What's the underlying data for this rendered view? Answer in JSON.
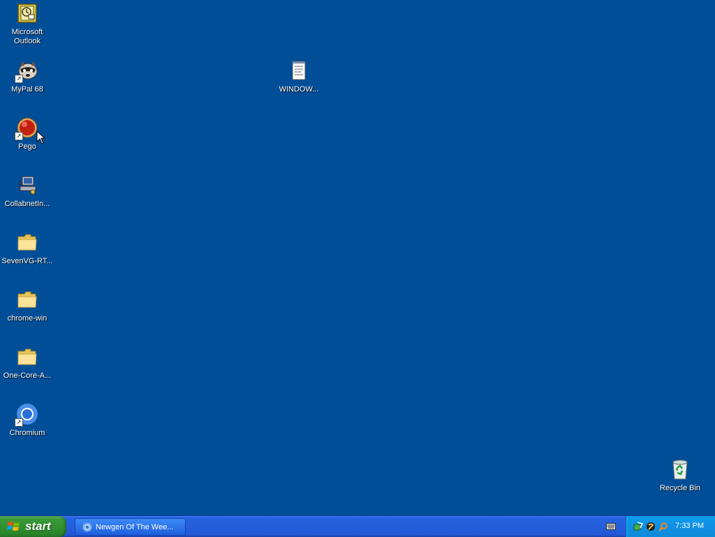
{
  "desktop": {
    "background_color": "#004e98",
    "icons": [
      {
        "label": "Microsoft\nOutlook",
        "icon": "outlook-icon",
        "shortcut": false
      },
      {
        "label": "MyPal 68",
        "icon": "mypal-raccoon-icon",
        "shortcut": true
      },
      {
        "label": "Pego",
        "icon": "pego-red-ball-icon",
        "shortcut": true
      },
      {
        "label": "CollabnetIn...",
        "icon": "computer-network-icon",
        "shortcut": false
      },
      {
        "label": "SevenVG-RT...",
        "icon": "folder-icon",
        "shortcut": false
      },
      {
        "label": "chrome-win",
        "icon": "folder-icon",
        "shortcut": false
      },
      {
        "label": "One-Core-A...",
        "icon": "folder-icon",
        "shortcut": false
      },
      {
        "label": "Chromium",
        "icon": "chromium-icon",
        "shortcut": true
      },
      {
        "label": "WINDOW...",
        "icon": "text-document-icon",
        "shortcut": false
      },
      {
        "label": "Recycle Bin",
        "icon": "recycle-bin-icon",
        "shortcut": false
      }
    ]
  },
  "taskbar": {
    "start_label": "start",
    "task_item_label": "Newgen Of The Wee...",
    "clock": "7:33 PM"
  }
}
